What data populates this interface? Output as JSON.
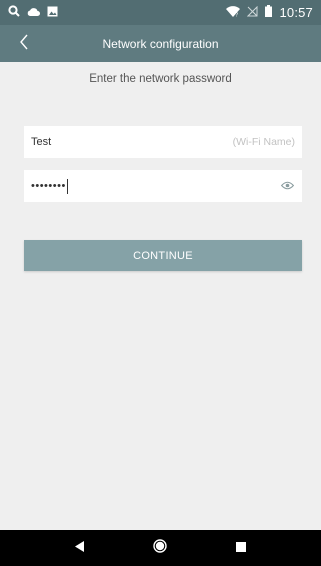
{
  "status_bar": {
    "time": "10:57",
    "icons_left": [
      "search-icon",
      "cloud-icon",
      "image-icon"
    ],
    "icons_right": [
      "wifi-icon",
      "no-sim-icon",
      "battery-icon"
    ]
  },
  "app_bar": {
    "title": "Network configuration",
    "back_icon": "chevron-left-icon"
  },
  "form": {
    "subtitle": "Enter the network password",
    "ssid": {
      "value": "Test",
      "hint": "(Wi-Fi Name)"
    },
    "password": {
      "masked_value": "••••••••",
      "visibility_icon": "eye-icon"
    },
    "continue_label": "CONTINUE"
  },
  "nav_bar": {
    "buttons": [
      "back-triangle-icon",
      "home-circle-icon",
      "recents-square-icon"
    ]
  },
  "colors": {
    "status_bar": "#526d72",
    "app_bar": "#5f7b80",
    "background": "#efefef",
    "button": "#85a2a7",
    "nav_bar": "#000000"
  }
}
